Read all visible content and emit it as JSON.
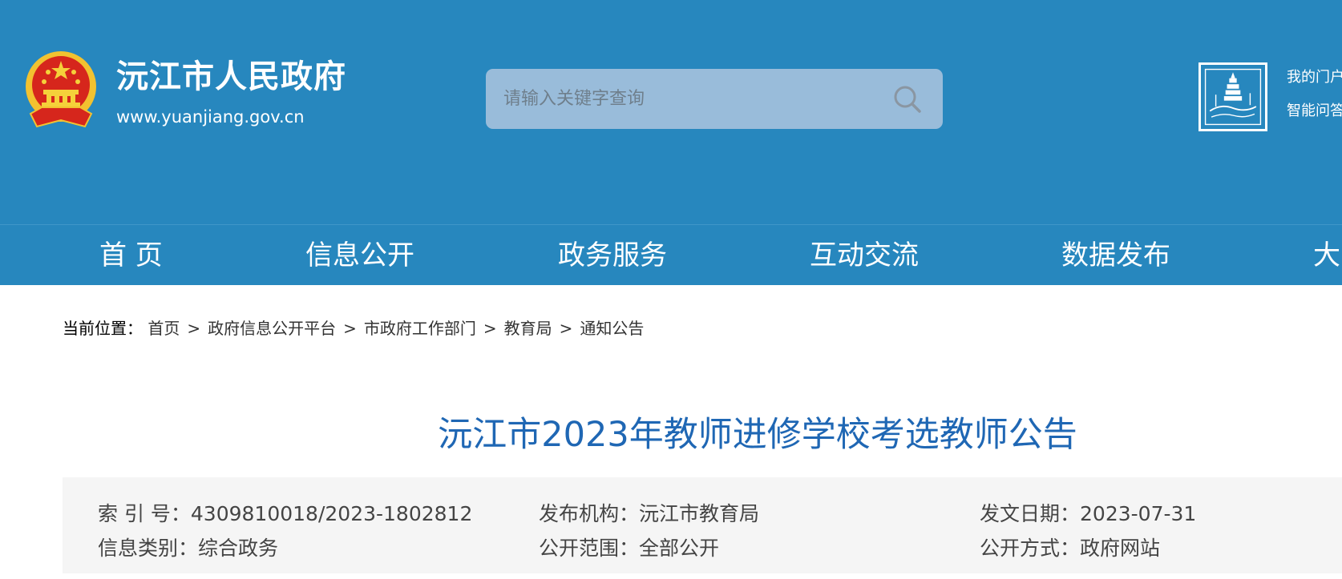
{
  "header": {
    "site_name": "沅江市人民政府",
    "site_url": "www.yuanjiang.gov.cn",
    "search_placeholder": "请输入关键字查询",
    "user_links": [
      "我的门户",
      "智能问答"
    ],
    "colors": {
      "header_bg": "#2787be",
      "search_bg": "#99bcda",
      "title_blue": "#1f67b4"
    }
  },
  "nav": {
    "items": [
      "首 页",
      "信息公开",
      "政务服务",
      "互动交流",
      "数据发布",
      "大"
    ]
  },
  "breadcrumb": {
    "label": "当前位置：",
    "items": [
      "首页",
      "政府信息公开平台",
      "市政府工作部门",
      "教育局",
      "通知公告"
    ],
    "separator": ">"
  },
  "article": {
    "title": "沅江市2023年教师进修学校考选教师公告"
  },
  "meta": {
    "row1": [
      {
        "label": "索 引 号：",
        "value": "4309810018/2023-1802812"
      },
      {
        "label": "发布机构：",
        "value": "沅江市教育局"
      },
      {
        "label": "发文日期：",
        "value": "2023-07-31"
      }
    ],
    "row2": [
      {
        "label": "信息类别：",
        "value": "综合政务"
      },
      {
        "label": "公开范围：",
        "value": "全部公开"
      },
      {
        "label": "公开方式：",
        "value": "政府网站"
      }
    ]
  },
  "icons": [
    "national-emblem-icon",
    "search-icon",
    "pagoda-seal-icon"
  ]
}
